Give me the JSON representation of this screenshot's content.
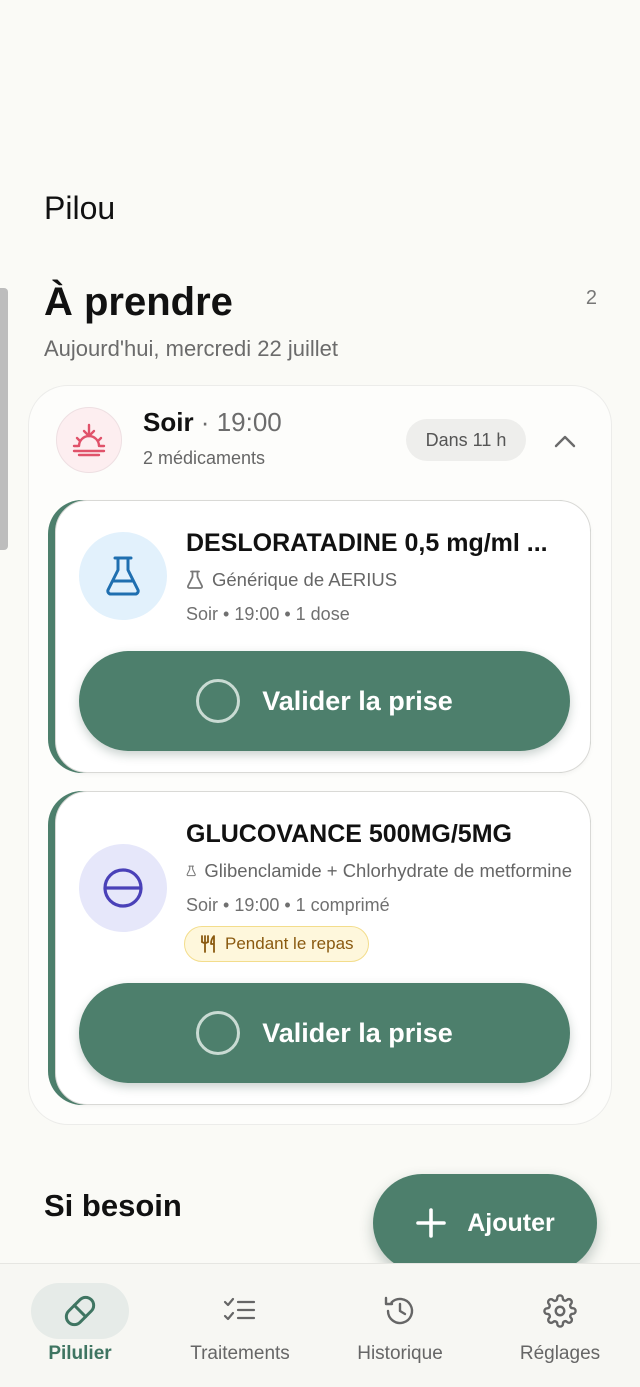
{
  "app": {
    "name": "Pilou"
  },
  "section": {
    "title": "À prendre",
    "count": "2",
    "date": "Aujourd'hui, mercredi 22 juillet"
  },
  "slot": {
    "name": "Soir",
    "separator": " · ",
    "time": "19:00",
    "subtitle": "2 médicaments",
    "due": "Dans 11 h",
    "icon": "sunset-icon"
  },
  "medications": [
    {
      "name": "DESLORATADINE 0,5 mg/ml ...",
      "generic": "Générique de AERIUS",
      "schedule": "Soir • 19:00 • 1 dose",
      "icon": "flask-icon",
      "validate_label": "Valider la prise"
    },
    {
      "name": "GLUCOVANCE 500MG/5MG",
      "generic": "Glibenclamide + Chlorhydrate de metformine",
      "schedule": "Soir • 19:00 • 1 comprimé",
      "badge": "Pendant le repas",
      "icon": "pill-minus-icon",
      "validate_label": "Valider la prise"
    }
  ],
  "as_needed": {
    "title": "Si besoin"
  },
  "fab": {
    "label": "Ajouter"
  },
  "nav": {
    "items": [
      {
        "label": "Pilulier",
        "icon": "pill-icon",
        "active": true
      },
      {
        "label": "Traitements",
        "icon": "checklist-icon",
        "active": false
      },
      {
        "label": "Historique",
        "icon": "history-icon",
        "active": false
      },
      {
        "label": "Réglages",
        "icon": "gear-icon",
        "active": false
      }
    ]
  },
  "colors": {
    "accent": "#4d7f6c",
    "background": "#fafaf6",
    "badge_bg": "#fef7dc",
    "badge_text": "#8a5a10"
  }
}
